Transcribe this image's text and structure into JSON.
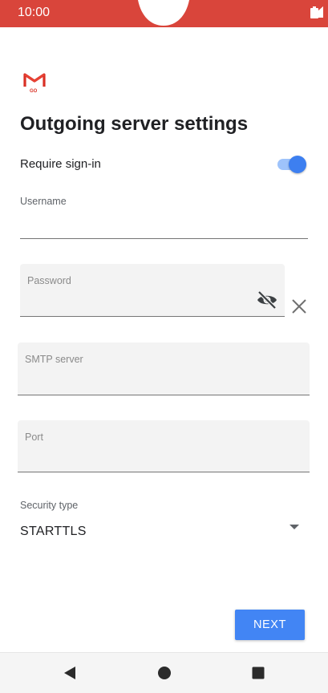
{
  "status_bar": {
    "time": "10:00",
    "color": "#d9453b",
    "icons": [
      "signal-icon",
      "signal-icon",
      "battery-icon"
    ]
  },
  "app": {
    "logo_icon": "gmail-go-logo",
    "logo_text": "GO"
  },
  "page": {
    "title": "Outgoing server settings"
  },
  "require_signin": {
    "label": "Require sign-in",
    "enabled": true
  },
  "username": {
    "label": "Username",
    "value": ""
  },
  "password": {
    "label": "Password",
    "value": "",
    "visibility_icon": "eye-off-icon",
    "clear_icon": "close-icon"
  },
  "smtp_server": {
    "label": "SMTP server",
    "value": ""
  },
  "port": {
    "label": "Port",
    "value": ""
  },
  "security_type": {
    "label": "Security type",
    "value": "STARTTLS"
  },
  "actions": {
    "next_label": "NEXT",
    "accent": "#4285f4"
  },
  "nav_bar": {
    "back_icon": "back-triangle-icon",
    "home_icon": "home-circle-icon",
    "recents_icon": "recents-square-icon"
  }
}
